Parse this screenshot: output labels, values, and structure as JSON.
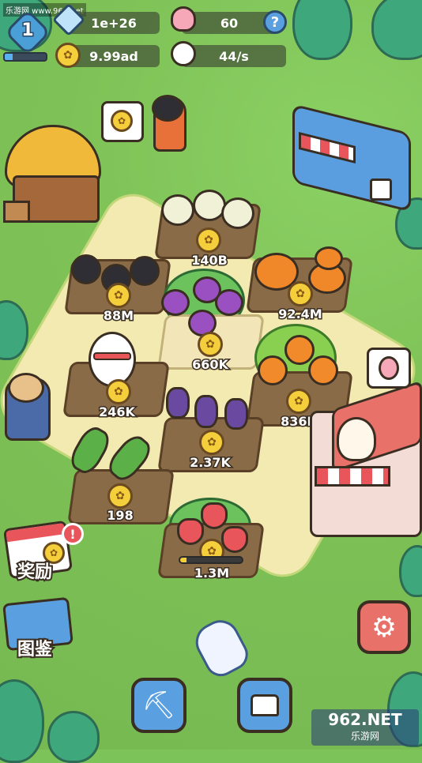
{
  "hud": {
    "level": "1",
    "gems_value": "1e+26",
    "icecream_value": "60",
    "help_symbol": "?",
    "coins_value": "9.99ad",
    "rate_value": "44/s"
  },
  "plots": [
    {
      "name": "plot-radish",
      "value": "140B"
    },
    {
      "name": "plot-coal",
      "value": "88M"
    },
    {
      "name": "plot-pumpkin",
      "value": "92.4M"
    },
    {
      "name": "plot-mangosteen",
      "value": "660K"
    },
    {
      "name": "plot-snowman",
      "value": "246K"
    },
    {
      "name": "plot-orange",
      "value": "836K"
    },
    {
      "name": "plot-eggplant",
      "value": "2.37K"
    },
    {
      "name": "plot-cucumber",
      "value": "198"
    },
    {
      "name": "plot-strawberry",
      "value": "1.3M"
    }
  ],
  "menu": {
    "rewards_label": "奖励",
    "rewards_badge": "!",
    "collection_label": "图鉴"
  },
  "watermark": {
    "site_top": "乐游网 www.962.net",
    "logo_main": "962.NET",
    "logo_sub": "乐游网"
  },
  "colors": {
    "grass": "#7cc35a",
    "path": "#f2eab0",
    "coin": "#f5cf3b",
    "shop_red": "#e8555b",
    "button_blue": "#5aa0e0",
    "button_settings": "#e8716a"
  }
}
